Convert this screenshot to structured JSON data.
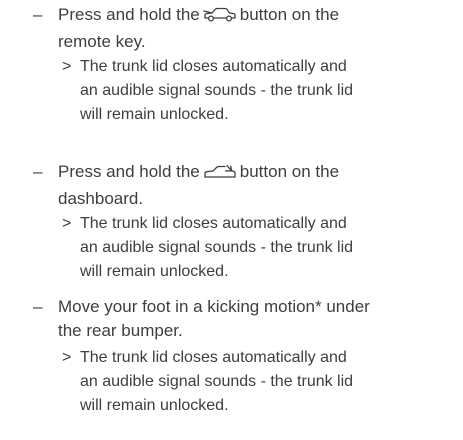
{
  "steps": [
    {
      "dash": "–",
      "text_before": "Press and hold the",
      "icon": "car-trunk-open-icon",
      "text_after": "button on the",
      "line2": "remote key.",
      "result_marker": ">",
      "result_lines": [
        "The trunk lid closes automatically and",
        "an audible signal sounds - the trunk lid",
        "will remain unlocked."
      ]
    },
    {
      "dash": "–",
      "text_before": "Press and hold the",
      "icon": "trunk-close-icon",
      "text_after": "button on the",
      "line2": "dashboard.",
      "result_marker": ">",
      "result_lines": [
        "The trunk lid closes automatically and",
        "an audible signal sounds - the trunk lid",
        "will remain unlocked."
      ]
    },
    {
      "dash": "–",
      "line1": "Move your foot in a kicking motion* under",
      "line2": "the rear bumper.",
      "result_marker": ">",
      "result_lines": [
        "The trunk lid closes automatically and",
        "an audible signal sounds - the trunk lid",
        "will remain unlocked."
      ]
    }
  ]
}
